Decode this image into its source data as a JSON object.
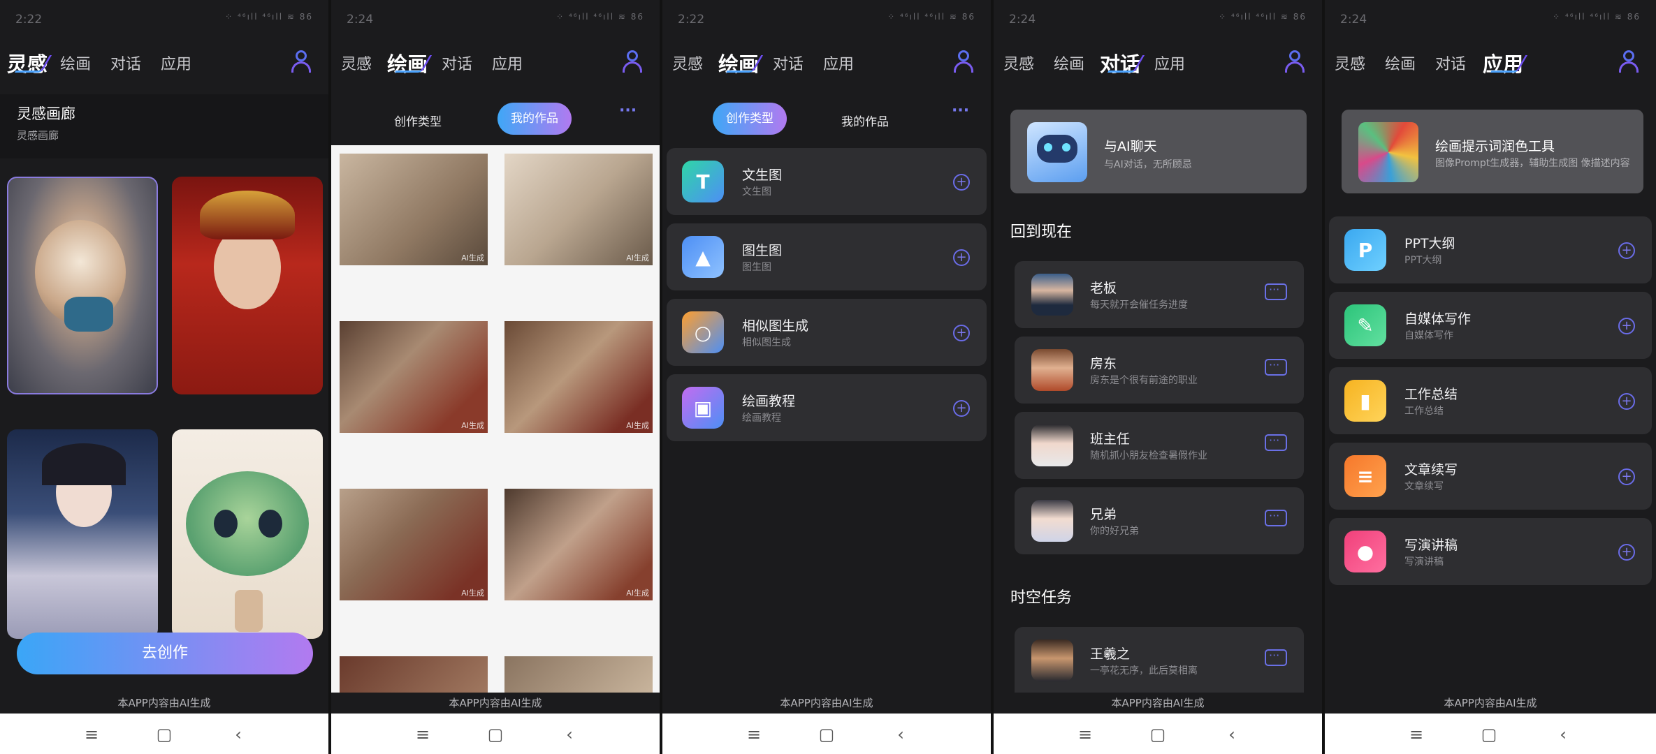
{
  "screens": [
    {
      "time": "2:22",
      "tabs": [
        "灵感",
        "绘画",
        "对话",
        "应用"
      ],
      "active": 0
    },
    {
      "time": "2:24",
      "tabs": [
        "灵感",
        "绘画",
        "对话",
        "应用"
      ],
      "active": 1
    },
    {
      "time": "2:22",
      "tabs": [
        "灵感",
        "绘画",
        "对话",
        "应用"
      ],
      "active": 1
    },
    {
      "time": "2:24",
      "tabs": [
        "灵感",
        "绘画",
        "对话",
        "应用"
      ],
      "active": 2
    },
    {
      "time": "2:24",
      "tabs": [
        "灵感",
        "绘画",
        "对话",
        "应用"
      ],
      "active": 3
    }
  ],
  "status_icons": "⁘ ⁴⁶ıll ⁴⁶ıll ≋ 86",
  "footer_note": "本APP内容由AI生成",
  "gallery": {
    "title": "灵感画廊",
    "subtitle": "灵感画廊",
    "create_button": "去创作"
  },
  "drawing": {
    "seg_type": "创作类型",
    "seg_works": "我的作品",
    "more": "···",
    "watermark": "AI生成",
    "items": [
      {
        "title": "文生图",
        "subtitle": "文生图",
        "icon": "text-image-icon",
        "color": "#2fd6a6"
      },
      {
        "title": "图生图",
        "subtitle": "图生图",
        "icon": "image-image-icon",
        "color": "#4d8ff5"
      },
      {
        "title": "相似图生成",
        "subtitle": "相似图生成",
        "icon": "similar-image-icon",
        "color": "#ff9f2e"
      },
      {
        "title": "绘画教程",
        "subtitle": "绘画教程",
        "icon": "tutorial-icon",
        "color": "#c36cf0"
      }
    ]
  },
  "chat": {
    "featured_title": "与AI聊天",
    "featured_subtitle": "与AI对话，无所顾忌",
    "section1": "回到现在",
    "roles": [
      {
        "name": "老板",
        "desc": "每天就开会催任务进度"
      },
      {
        "name": "房东",
        "desc": "房东是个很有前途的职业"
      },
      {
        "name": "班主任",
        "desc": "随机抓小朋友检查暑假作业"
      },
      {
        "name": "兄弟",
        "desc": "你的好兄弟"
      }
    ],
    "section2": "时空任务",
    "roles2": [
      {
        "name": "王羲之",
        "desc": "一亭花无序，此后莫相离"
      }
    ]
  },
  "apps": {
    "featured_title": "绘画提示词润色工具",
    "featured_subtitle": "图像Prompt生成器，辅助生成图 像描述内容",
    "items": [
      {
        "title": "PPT大纲",
        "subtitle": "PPT大纲",
        "icon": "ppt-icon",
        "color": "#3aa8f0"
      },
      {
        "title": "自媒体写作",
        "subtitle": "自媒体写作",
        "icon": "feather-icon",
        "color": "#2cc47a"
      },
      {
        "title": "工作总结",
        "subtitle": "工作总结",
        "icon": "chart-icon",
        "color": "#f6b321"
      },
      {
        "title": "文章续写",
        "subtitle": "文章续写",
        "icon": "document-edit-icon",
        "color": "#f6782b"
      },
      {
        "title": "写演讲稿",
        "subtitle": "写演讲稿",
        "icon": "microphone-icon",
        "color": "#f0407a"
      }
    ]
  },
  "sysnav": {
    "menu": "≡",
    "home": "▢",
    "back": "‹"
  }
}
